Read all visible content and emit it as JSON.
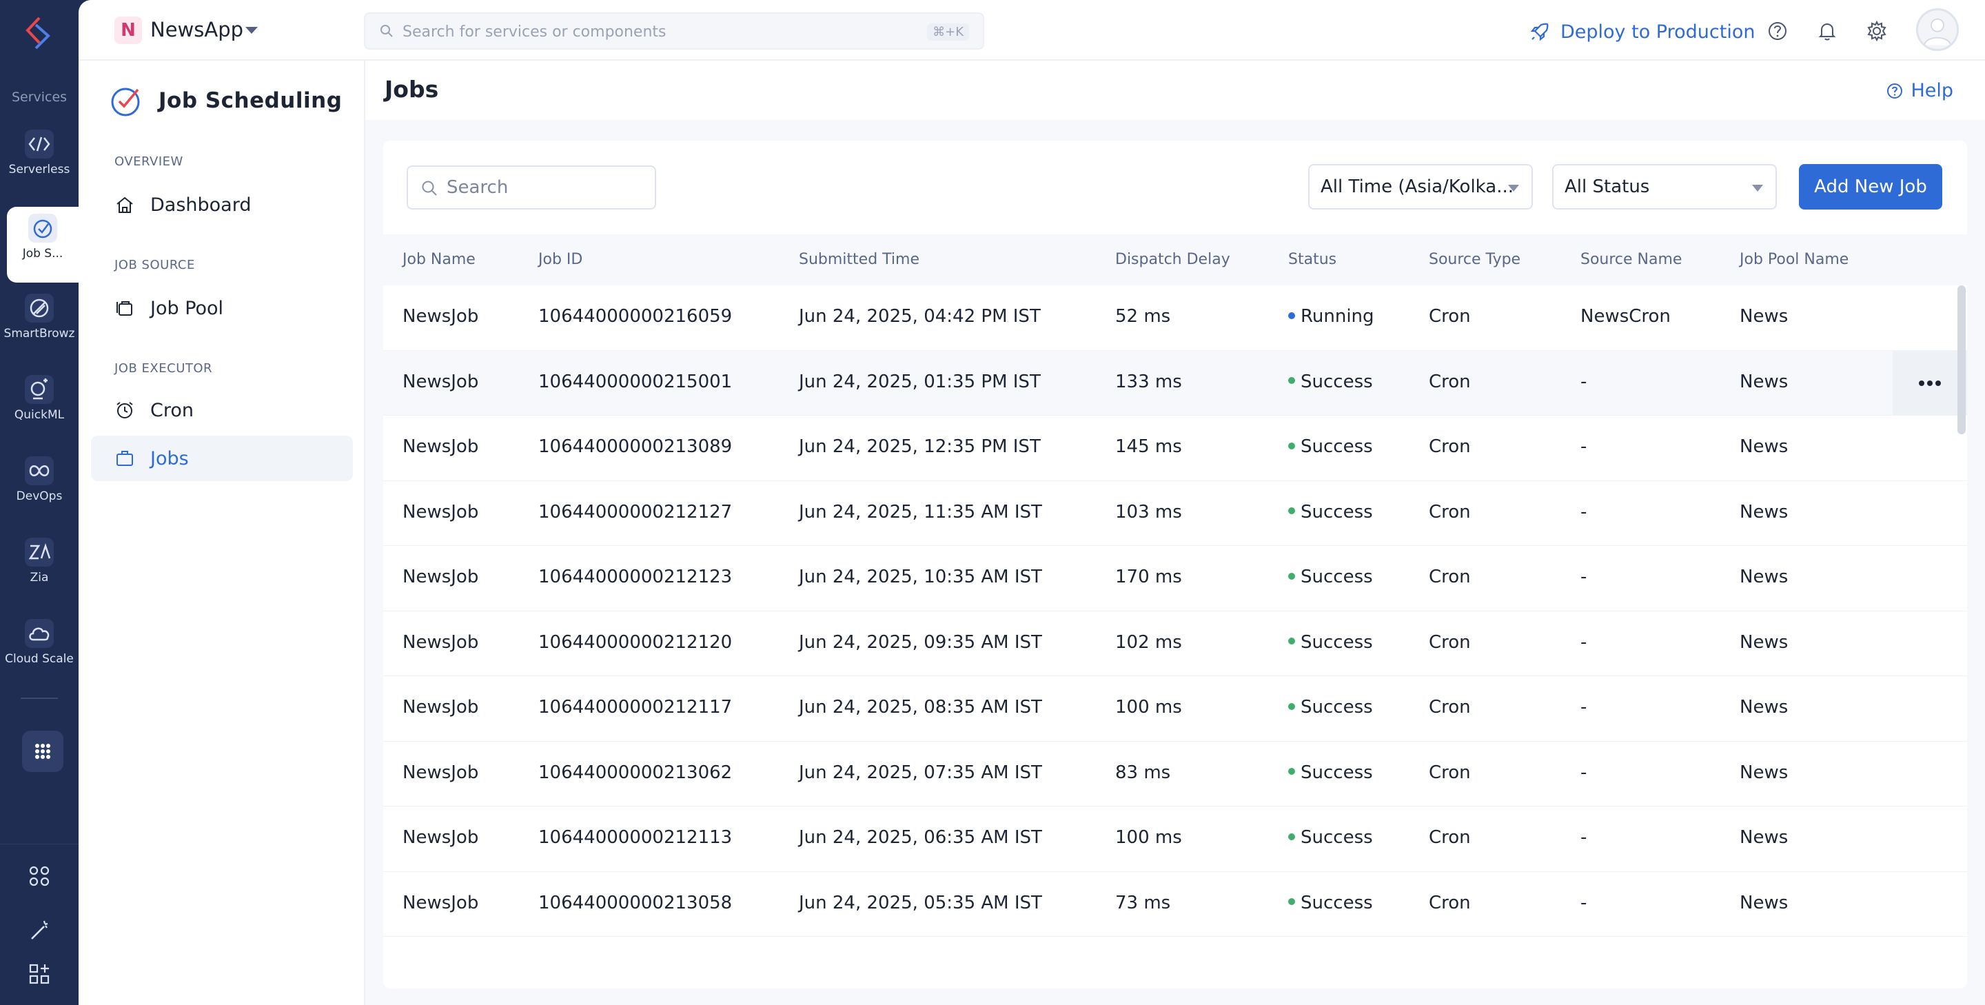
{
  "rail": {
    "section_label": "Services",
    "items": [
      {
        "label": "Serverless",
        "icon": "serverless-icon"
      },
      {
        "label": "Job S...",
        "icon": "job-scheduling-icon"
      },
      {
        "label": "SmartBrowz",
        "icon": "smartbrowz-icon"
      },
      {
        "label": "QuickML",
        "icon": "quickml-icon"
      },
      {
        "label": "DevOps",
        "icon": "devops-icon"
      },
      {
        "label": "Zia",
        "icon": "zia-icon"
      },
      {
        "label": "Cloud Scale",
        "icon": "cloud-scale-icon"
      }
    ],
    "active_index": 1
  },
  "topbar": {
    "app_initial": "N",
    "app_name": "NewsApp",
    "search_placeholder": "Search for services or components",
    "search_shortcut": "⌘+K",
    "deploy_label": "Deploy to Production"
  },
  "sidenav": {
    "title": "Job Scheduling",
    "groups": [
      {
        "label": "OVERVIEW",
        "items": [
          {
            "label": "Dashboard",
            "icon": "home-icon"
          }
        ]
      },
      {
        "label": "JOB SOURCE",
        "items": [
          {
            "label": "Job Pool",
            "icon": "job-pool-icon"
          }
        ]
      },
      {
        "label": "JOB EXECUTOR",
        "items": [
          {
            "label": "Cron",
            "icon": "alarm-clock-icon"
          },
          {
            "label": "Jobs",
            "icon": "briefcase-icon"
          }
        ]
      }
    ],
    "active_item": "Jobs"
  },
  "main": {
    "title": "Jobs",
    "help_label": "Help",
    "search_placeholder": "Search",
    "time_filter": "All Time (Asia/Kolka...",
    "status_filter": "All Status",
    "add_button": "Add New Job",
    "columns": [
      "Job Name",
      "Job ID",
      "Submitted Time",
      "Dispatch Delay",
      "Status",
      "Source Type",
      "Source Name",
      "Job Pool Name"
    ],
    "rows": [
      {
        "name": "NewsJob",
        "id": "10644000000216059",
        "time": "Jun 24, 2025, 04:42 PM IST",
        "delay": "52 ms",
        "status": "Running",
        "source_type": "Cron",
        "source_name": "NewsCron",
        "pool": "News"
      },
      {
        "name": "NewsJob",
        "id": "10644000000215001",
        "time": "Jun 24, 2025, 01:35 PM IST",
        "delay": "133 ms",
        "status": "Success",
        "source_type": "Cron",
        "source_name": "-",
        "pool": "News"
      },
      {
        "name": "NewsJob",
        "id": "10644000000213089",
        "time": "Jun 24, 2025, 12:35 PM IST",
        "delay": "145 ms",
        "status": "Success",
        "source_type": "Cron",
        "source_name": "-",
        "pool": "News"
      },
      {
        "name": "NewsJob",
        "id": "10644000000212127",
        "time": "Jun 24, 2025, 11:35 AM IST",
        "delay": "103 ms",
        "status": "Success",
        "source_type": "Cron",
        "source_name": "-",
        "pool": "News"
      },
      {
        "name": "NewsJob",
        "id": "10644000000212123",
        "time": "Jun 24, 2025, 10:35 AM IST",
        "delay": "170 ms",
        "status": "Success",
        "source_type": "Cron",
        "source_name": "-",
        "pool": "News"
      },
      {
        "name": "NewsJob",
        "id": "10644000000212120",
        "time": "Jun 24, 2025, 09:35 AM IST",
        "delay": "102 ms",
        "status": "Success",
        "source_type": "Cron",
        "source_name": "-",
        "pool": "News"
      },
      {
        "name": "NewsJob",
        "id": "10644000000212117",
        "time": "Jun 24, 2025, 08:35 AM IST",
        "delay": "100 ms",
        "status": "Success",
        "source_type": "Cron",
        "source_name": "-",
        "pool": "News"
      },
      {
        "name": "NewsJob",
        "id": "10644000000213062",
        "time": "Jun 24, 2025, 07:35 AM IST",
        "delay": "83 ms",
        "status": "Success",
        "source_type": "Cron",
        "source_name": "-",
        "pool": "News"
      },
      {
        "name": "NewsJob",
        "id": "10644000000212113",
        "time": "Jun 24, 2025, 06:35 AM IST",
        "delay": "100 ms",
        "status": "Success",
        "source_type": "Cron",
        "source_name": "-",
        "pool": "News"
      },
      {
        "name": "NewsJob",
        "id": "10644000000213058",
        "time": "Jun 24, 2025, 05:35 AM IST",
        "delay": "73 ms",
        "status": "Success",
        "source_type": "Cron",
        "source_name": "-",
        "pool": "News"
      }
    ],
    "hover_row_index": 1
  },
  "colors": {
    "rail_bg": "#1f2d52",
    "accent": "#2f6bd7",
    "status_running": "#2f6bd7",
    "status_success": "#3fae6b"
  }
}
